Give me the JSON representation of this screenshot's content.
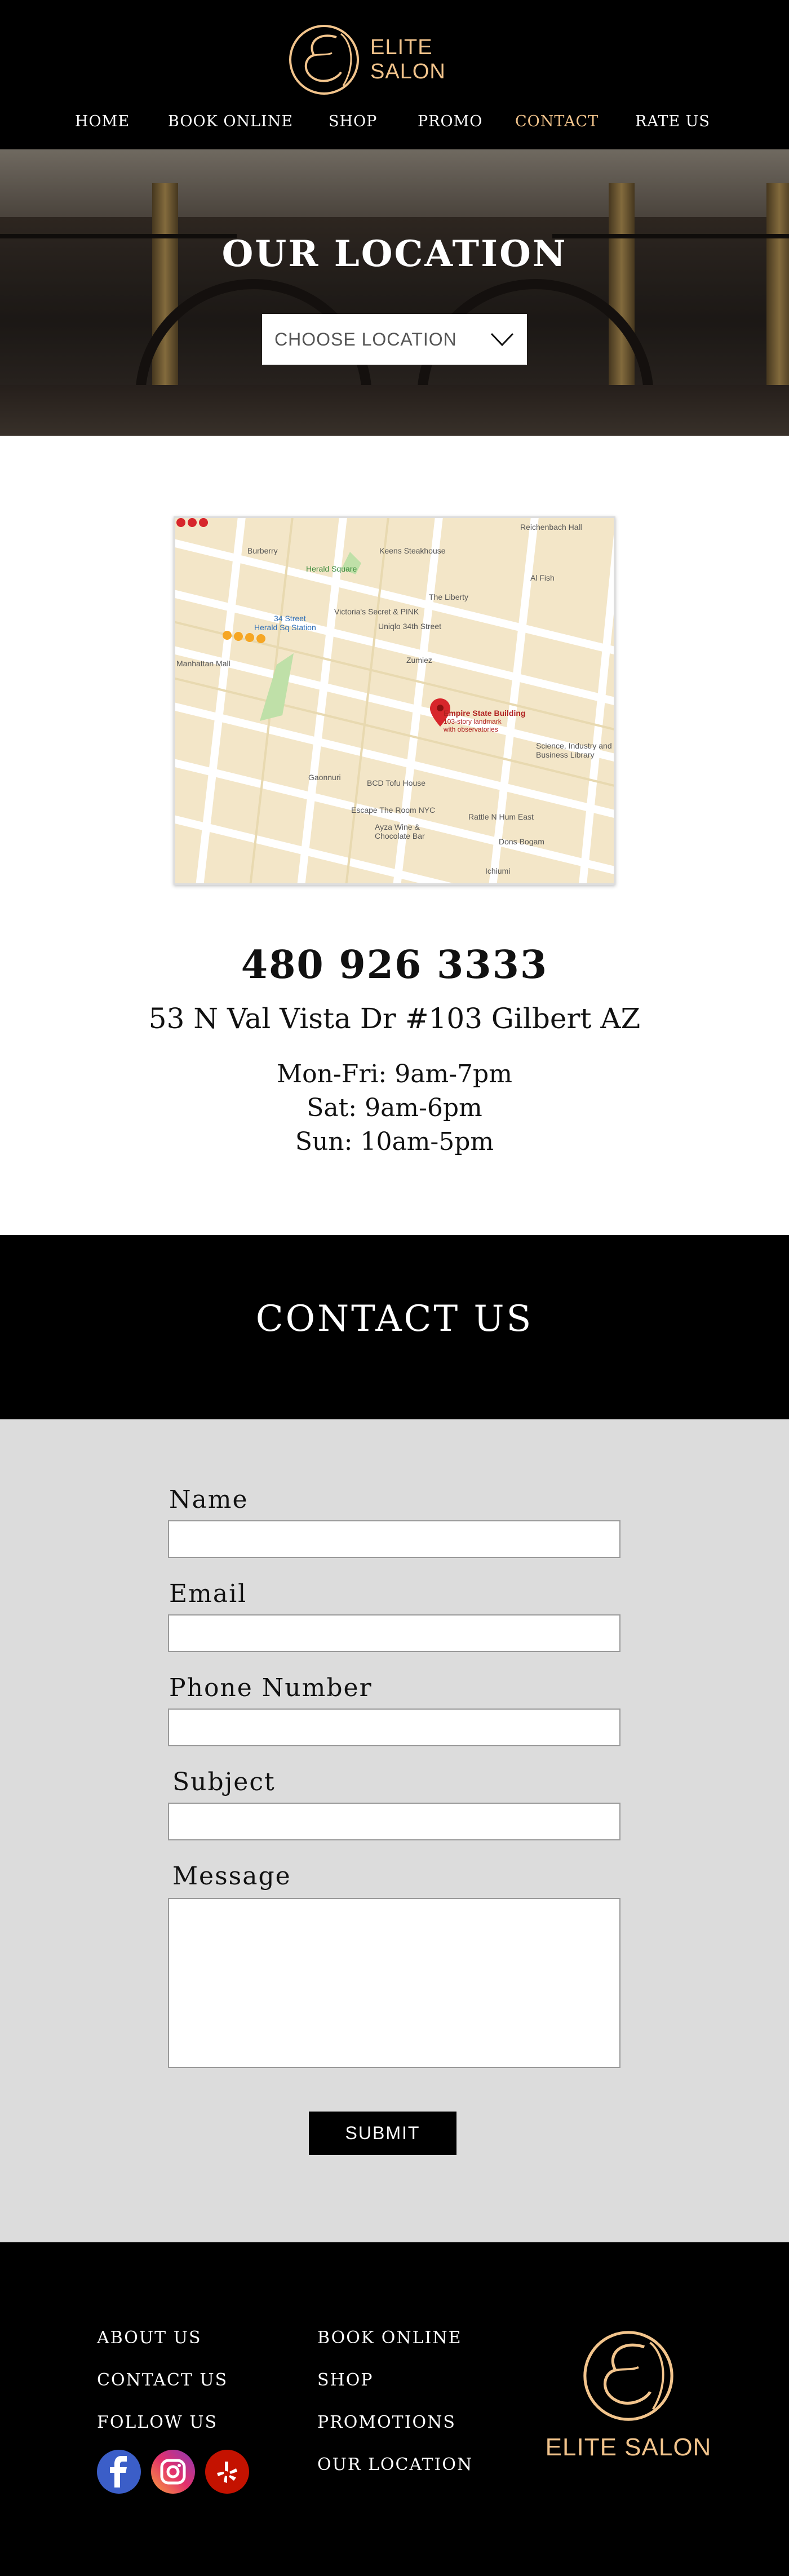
{
  "brand": {
    "name": "ELITE SALON",
    "accent": "#f2c48c"
  },
  "nav": {
    "items": [
      {
        "label": "HOME"
      },
      {
        "label": "BOOK ONLINE"
      },
      {
        "label": "SHOP"
      },
      {
        "label": "PROMO"
      },
      {
        "label": "CONTACT",
        "active": true
      },
      {
        "label": "RATE US"
      }
    ]
  },
  "hero": {
    "title": "OUR LOCATION",
    "dropdown_label": "CHOOSE LOCATION"
  },
  "map": {
    "labels": [
      "Reichenbach Hall",
      "Burberry",
      "Keens Steakhouse",
      "Herald Square",
      "Al Fish",
      "The Liberty",
      "34 Street",
      "Victoria's Secret & PINK",
      "Herald Sq Station",
      "Uniqlo 34th Street",
      "Manhattan Mall",
      "Zumiez",
      "Empire State Building",
      "103-story landmark",
      "with observatories",
      "Science, Industry and Business Library",
      "BCD Tofu House",
      "Gaonnuri",
      "Escape The Room NYC",
      "Ayza Wine & Chocolate Bar",
      "Rattle N Hum East",
      "Dons Bogam",
      "Ichiumi"
    ]
  },
  "info": {
    "phone": "480 926 3333",
    "address": "53 N Val Vista Dr #103 Gilbert AZ",
    "hours": [
      "Mon-Fri: 9am-7pm",
      "Sat: 9am-6pm",
      "Sun: 10am-5pm"
    ]
  },
  "contact": {
    "title": "CONTACT US",
    "fields": {
      "name": "Name",
      "email": "Email",
      "phone": "Phone Number",
      "subject": "Subject",
      "message": "Message"
    },
    "submit": "SUBMIT"
  },
  "footer": {
    "col1": [
      "ABOUT US",
      "CONTACT US",
      "FOLLOW US"
    ],
    "col2": [
      "BOOK ONLINE",
      "SHOP",
      "PROMOTIONS",
      "OUR LOCATION"
    ],
    "social": [
      "facebook-icon",
      "instagram-icon",
      "yelp-icon"
    ]
  }
}
